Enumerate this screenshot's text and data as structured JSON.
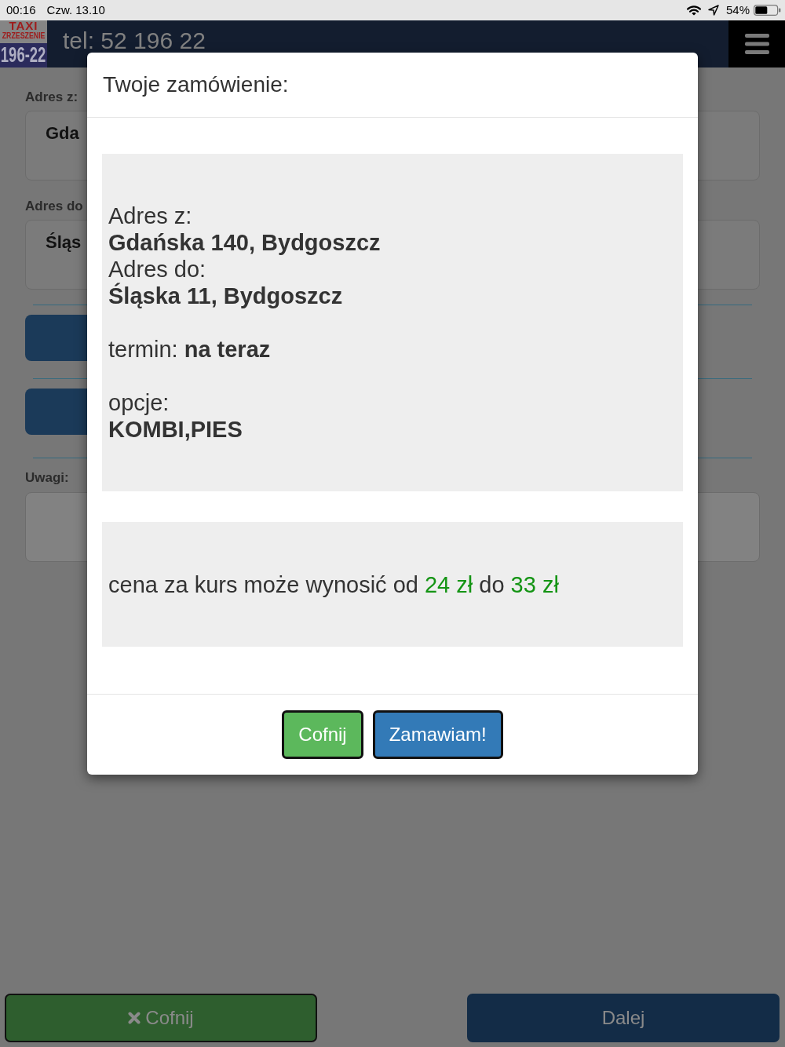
{
  "status_bar": {
    "time": "00:16",
    "date": "Czw. 13.10",
    "battery": "54%"
  },
  "header": {
    "logo": [
      "TAXI",
      "ZRZESZENIE",
      "196-22"
    ],
    "phone": "tel: 52 196 22"
  },
  "form": {
    "fields": [
      {
        "label": "Adres z:",
        "value": "Gda"
      },
      {
        "label": "Adres do",
        "value": "Śląs"
      }
    ],
    "notes": {
      "label": "Uwagi:"
    }
  },
  "bottom_bar": {
    "buttons": [
      {
        "kind": "back",
        "label": "Cofnij"
      },
      {
        "kind": "next",
        "label": "Dalej"
      }
    ]
  },
  "dialog": {
    "title": "Twoje zamówienie:",
    "summary": [
      {
        "lines": [
          {
            "kind": "label",
            "text": "Adres z:"
          },
          {
            "kind": "value",
            "text": "Gdańska 140, Bydgoszcz"
          },
          {
            "kind": "label",
            "text": "Adres do:"
          },
          {
            "kind": "value",
            "text": "Śląska 11, Bydgoszcz"
          }
        ]
      },
      {
        "lines": [
          {
            "kind": "rich",
            "text": "termin: **na teraz**"
          }
        ]
      },
      {
        "lines": [
          {
            "kind": "label",
            "text": "opcje:"
          },
          {
            "kind": "value",
            "text": "KOMBI,PIES"
          }
        ]
      }
    ],
    "price": {
      "prefix": "cena za kurs może wynosić od",
      "min": "24 zł",
      "middle": "do",
      "max": "33 zł"
    },
    "buttons": [
      {
        "kind": "back",
        "label": "Cofnij"
      },
      {
        "kind": "confirm",
        "label": "Zamawiam!"
      }
    ]
  }
}
